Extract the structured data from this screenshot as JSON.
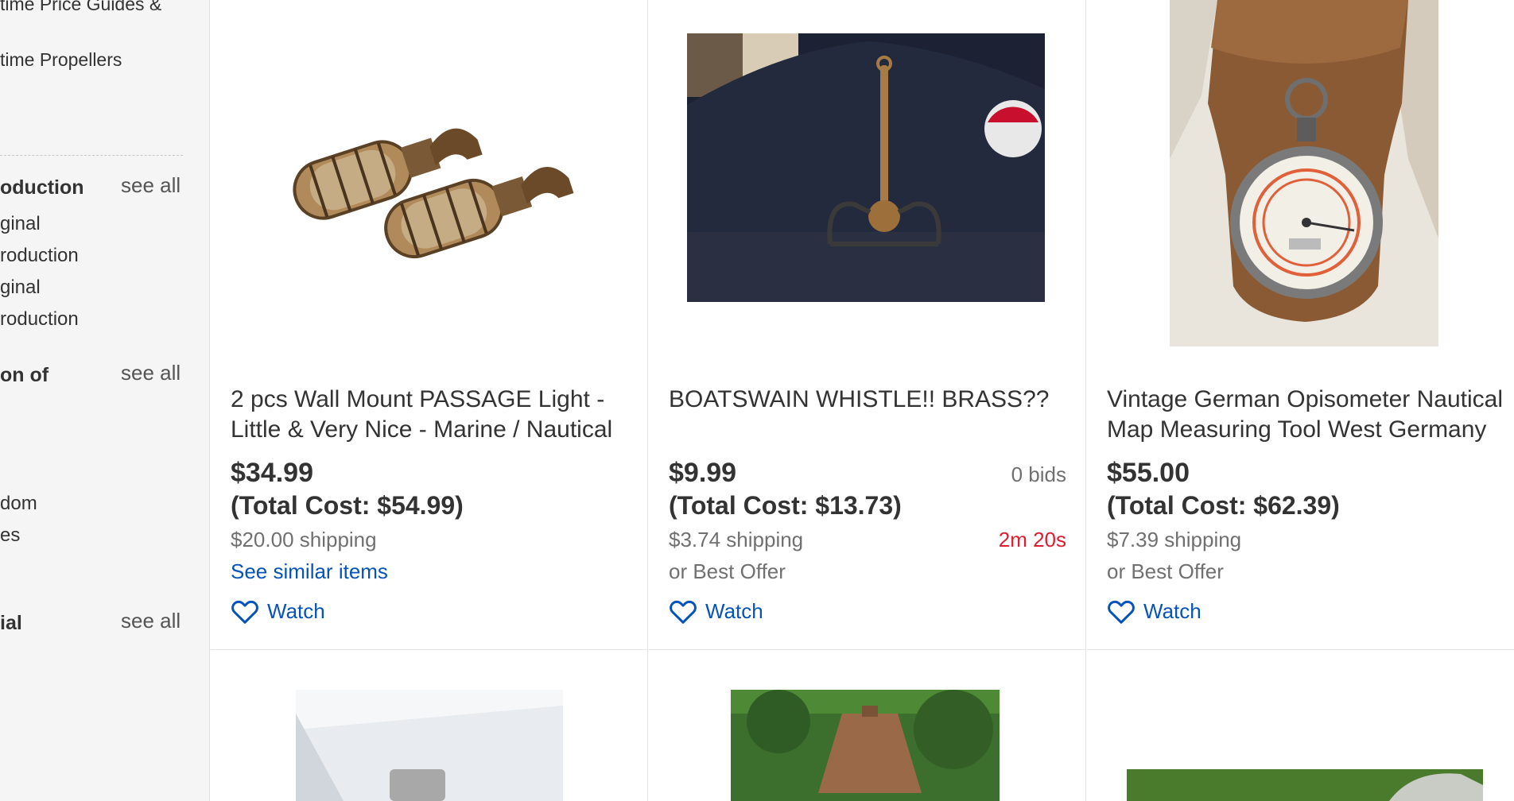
{
  "sidebar": {
    "cut_line_top": "time Price Guides &",
    "cut_line_2": "time Propellers",
    "sections": [
      {
        "heading": "oduction",
        "see_all": "see all",
        "items": [
          "ginal",
          "roduction",
          "ginal",
          "roduction"
        ]
      },
      {
        "heading": "on of",
        "see_all": "see all",
        "items": [
          "dom",
          "es"
        ]
      },
      {
        "heading": "ial",
        "see_all": "see all",
        "items": []
      }
    ]
  },
  "listings": [
    {
      "title": "2 pcs Wall Mount PASSAGE Light - Little & Very Nice - Marine / Nautical",
      "price": "$34.99",
      "total": "(Total Cost: $54.99)",
      "shipping": "$20.00 shipping",
      "link": "See similar items",
      "watch": "Watch"
    },
    {
      "title": "BOATSWAIN WHISTLE!! BRASS??",
      "price": "$9.99",
      "bids": "0 bids",
      "total": "(Total Cost: $13.73)",
      "shipping": "$3.74 shipping",
      "time_left": "2m 20s",
      "offer": "or Best Offer",
      "watch": "Watch"
    },
    {
      "title": "Vintage German Opisometer Nautical Map Measuring Tool West Germany",
      "price": "$55.00",
      "total": "(Total Cost: $62.39)",
      "shipping": "$7.39 shipping",
      "offer": "or Best Offer",
      "watch": "Watch"
    }
  ],
  "colors": {
    "link": "#0654ba",
    "timer": "#dd1e31",
    "muted": "#707070"
  },
  "icons": {
    "watch": "heart-outline-icon"
  }
}
